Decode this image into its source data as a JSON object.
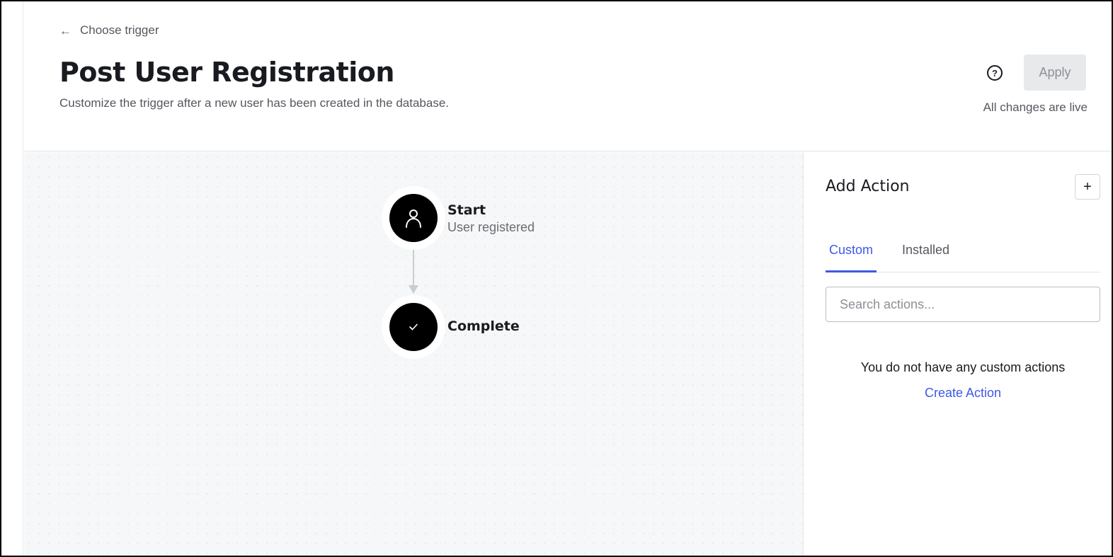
{
  "header": {
    "back_label": "Choose trigger",
    "title": "Post User Registration",
    "subtitle": "Customize the trigger after a new user has been created in the database.",
    "help_symbol": "?",
    "apply_label": "Apply",
    "status": "All changes are live"
  },
  "flow": {
    "start": {
      "title": "Start",
      "subtitle": "User registered",
      "icon": "user-icon"
    },
    "complete": {
      "title": "Complete",
      "icon": "check-icon"
    }
  },
  "panel": {
    "title": "Add Action",
    "add_symbol": "+",
    "tabs": [
      {
        "label": "Custom",
        "active": true
      },
      {
        "label": "Installed",
        "active": false
      }
    ],
    "search_placeholder": "Search actions...",
    "empty_message": "You do not have any custom actions",
    "create_link": "Create Action"
  },
  "colors": {
    "accent": "#3f59e4",
    "node": "#000000",
    "canvas": "#f6f7f8"
  }
}
